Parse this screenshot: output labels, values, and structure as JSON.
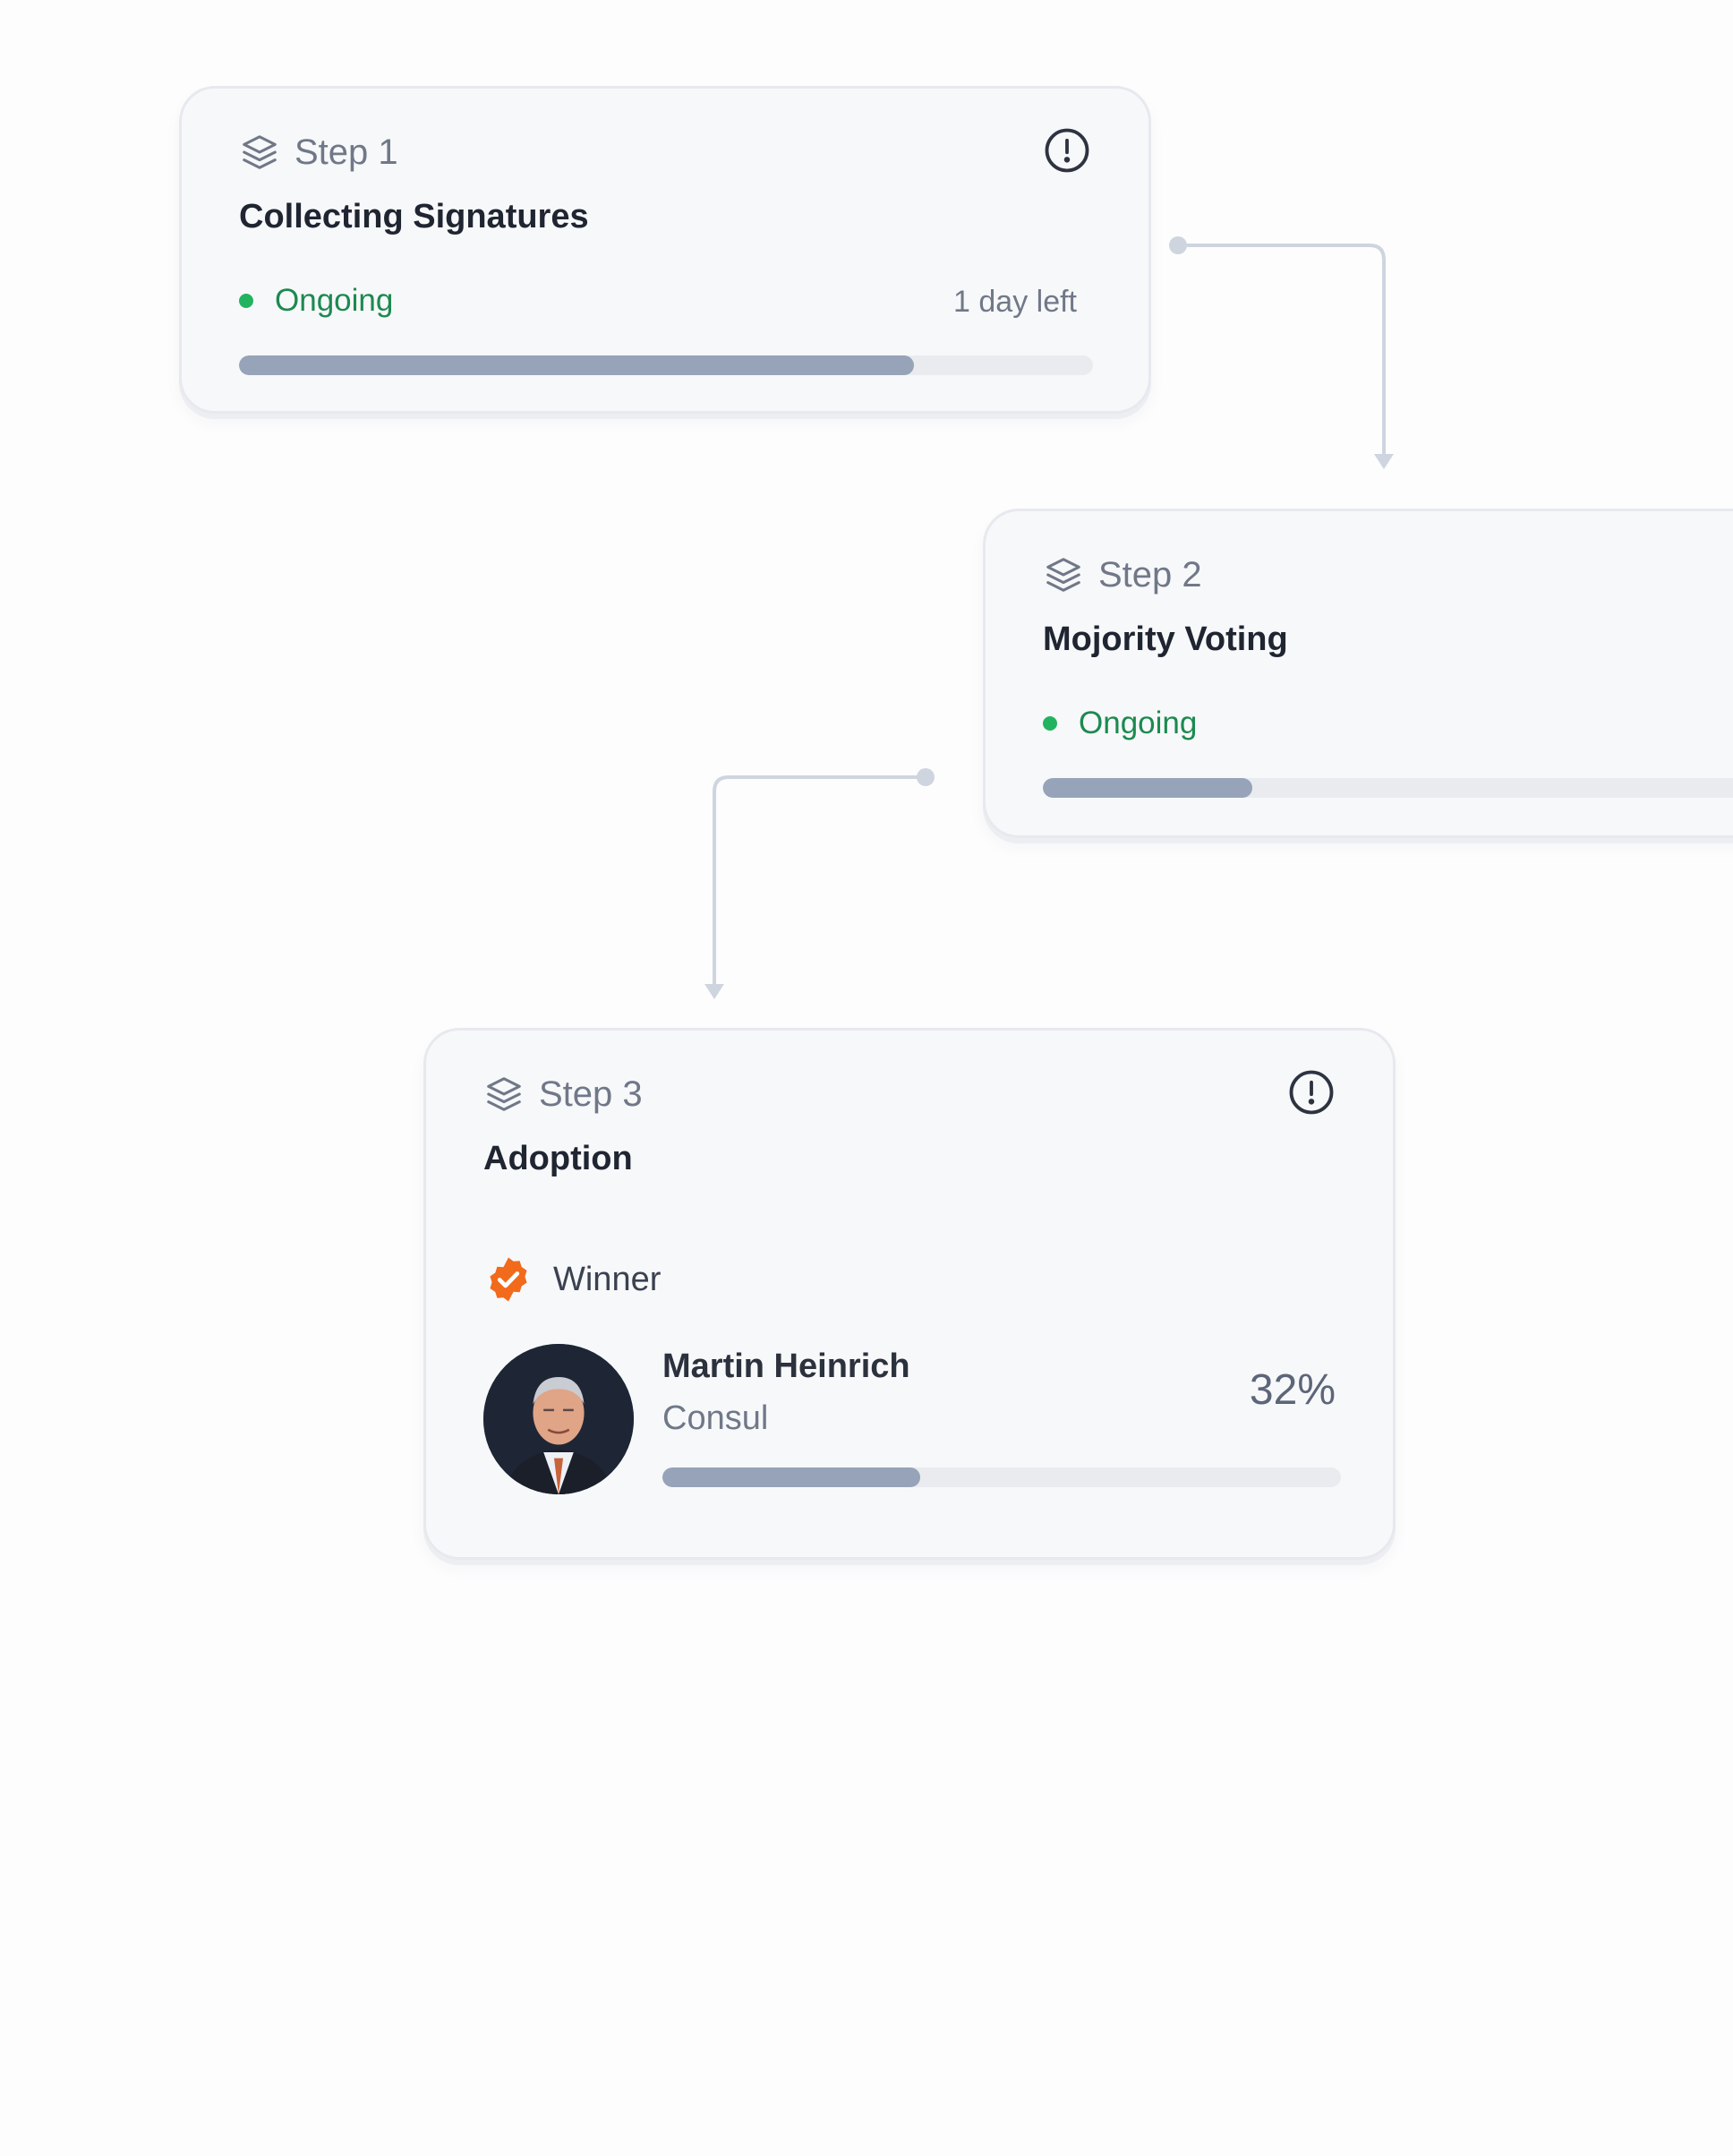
{
  "steps": [
    {
      "step_label": "Step 1",
      "title": "Collecting Signatures",
      "status": "Ongoing",
      "time_left": "1 day left",
      "progress": 0.79
    },
    {
      "step_label": "Step 2",
      "title": "Mojority Voting",
      "status": "Ongoing",
      "progress": 0.28
    },
    {
      "step_label": "Step 3",
      "title": "Adoption",
      "winner_label": "Winner",
      "candidate": {
        "name": "Martin Heinrich",
        "role": "Consul",
        "percent": "32%",
        "progress": 0.38
      }
    }
  ],
  "colors": {
    "status_green": "#22b35e",
    "status_text": "#1c8a50",
    "progress_fill": "#96a3b8",
    "progress_track": "#e9ebef",
    "winner_badge": "#f26a1b",
    "connector": "#cfd5df"
  },
  "icons": {
    "step": "layers-icon",
    "info": "exclamation-circle-icon",
    "winner": "verified-badge-icon"
  }
}
